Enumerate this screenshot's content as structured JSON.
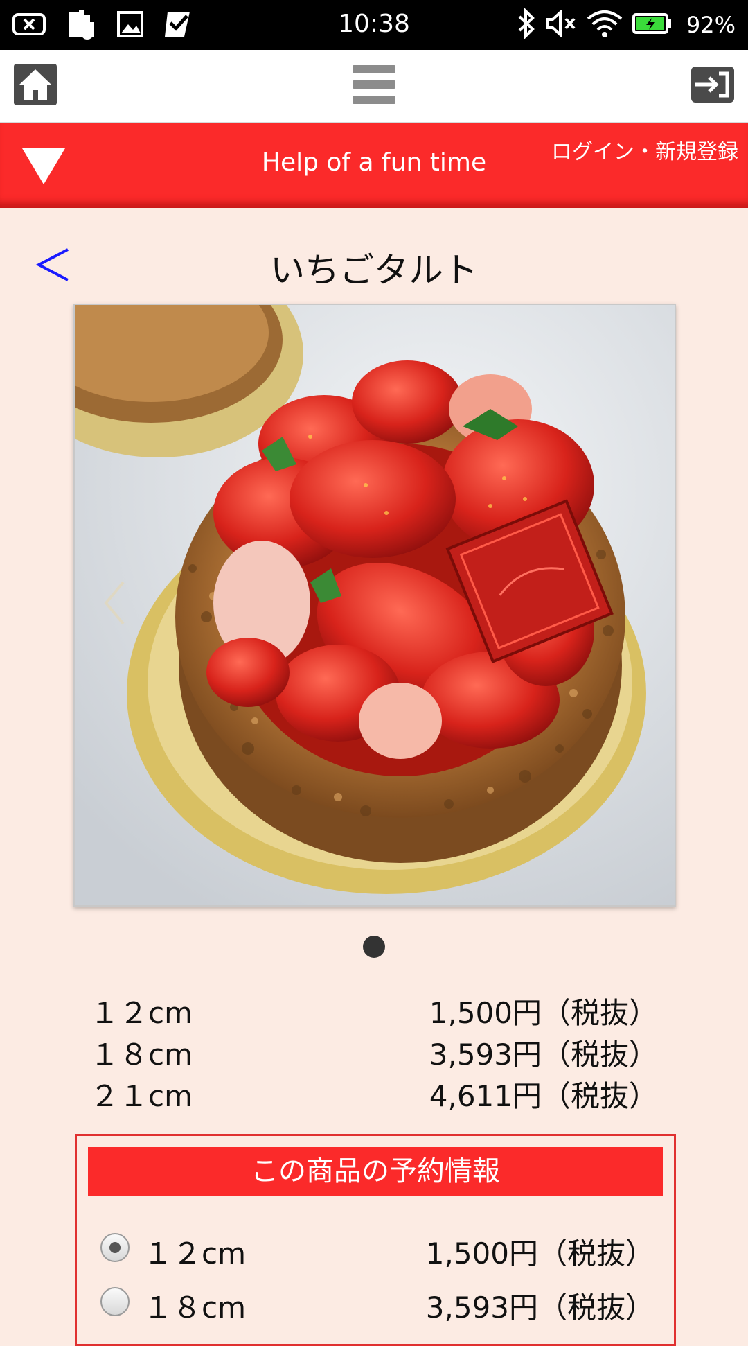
{
  "status_bar": {
    "time": "10:38",
    "battery_percent": "92%",
    "left_icons": [
      "screen-record-icon",
      "sd-card-icon",
      "image-icon",
      "checkbox-icon"
    ],
    "right_icons": [
      "bluetooth-icon",
      "mute-icon",
      "wifi-icon",
      "battery-icon"
    ]
  },
  "toolbar": {
    "home_icon": "home-icon",
    "menu_icon": "hamburger-menu-icon",
    "logout_icon": "logout-icon"
  },
  "banner": {
    "title": "Help of a fun time",
    "login_link": "ログイン・新規登録"
  },
  "product": {
    "back_symbol": "<",
    "name": "いちごタルト",
    "prices": [
      {
        "size": "１２cm",
        "price": "1,500円（税抜）"
      },
      {
        "size": "１８cm",
        "price": "3,593円（税抜）"
      },
      {
        "size": "２１cm",
        "price": "4,611円（税抜）"
      }
    ]
  },
  "reservation": {
    "header": "この商品の予約情報",
    "options": [
      {
        "size": "１２cm",
        "price": "1,500円（税抜）",
        "selected": true
      },
      {
        "size": "１８cm",
        "price": "3,593円（税抜）",
        "selected": false
      }
    ]
  },
  "colors": {
    "banner_red": "#fb2a2a",
    "page_bg": "#fcebe3",
    "back_blue": "#1a1aff"
  }
}
